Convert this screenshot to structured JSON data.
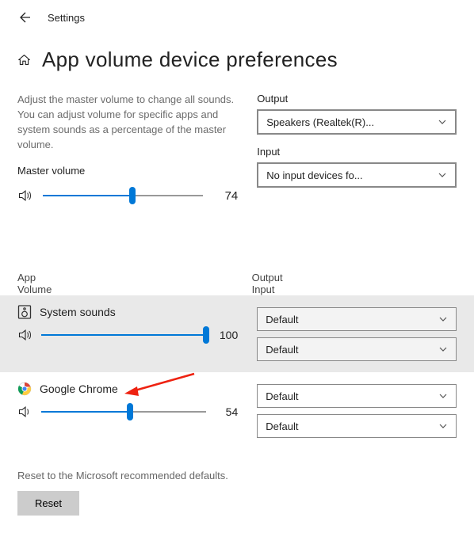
{
  "header": {
    "title": "Settings"
  },
  "page": {
    "title": "App volume  device preferences"
  },
  "master": {
    "description": "Adjust the master volume to change all sounds. You can adjust volume for specific apps and system sounds as a percentage of the master volume.",
    "label": "Master volume",
    "value": 74
  },
  "devices": {
    "output_label": "Output",
    "output_selected": "Speakers (Realtek(R)...",
    "input_label": "Input",
    "input_selected": "No input devices fo..."
  },
  "table": {
    "col_left_line1": "App",
    "col_left_line2": "Volume",
    "col_right_line1": "Output",
    "col_right_line2": "Input"
  },
  "apps": [
    {
      "name": "System sounds",
      "icon": "speaker-box-icon",
      "volume": 100,
      "output": "Default",
      "input": "Default",
      "highlight": true
    },
    {
      "name": "Google Chrome",
      "icon": "chrome-icon",
      "volume": 54,
      "output": "Default",
      "input": "Default",
      "highlight": false
    }
  ],
  "footer": {
    "text": "Reset to the Microsoft recommended defaults.",
    "button": "Reset"
  }
}
